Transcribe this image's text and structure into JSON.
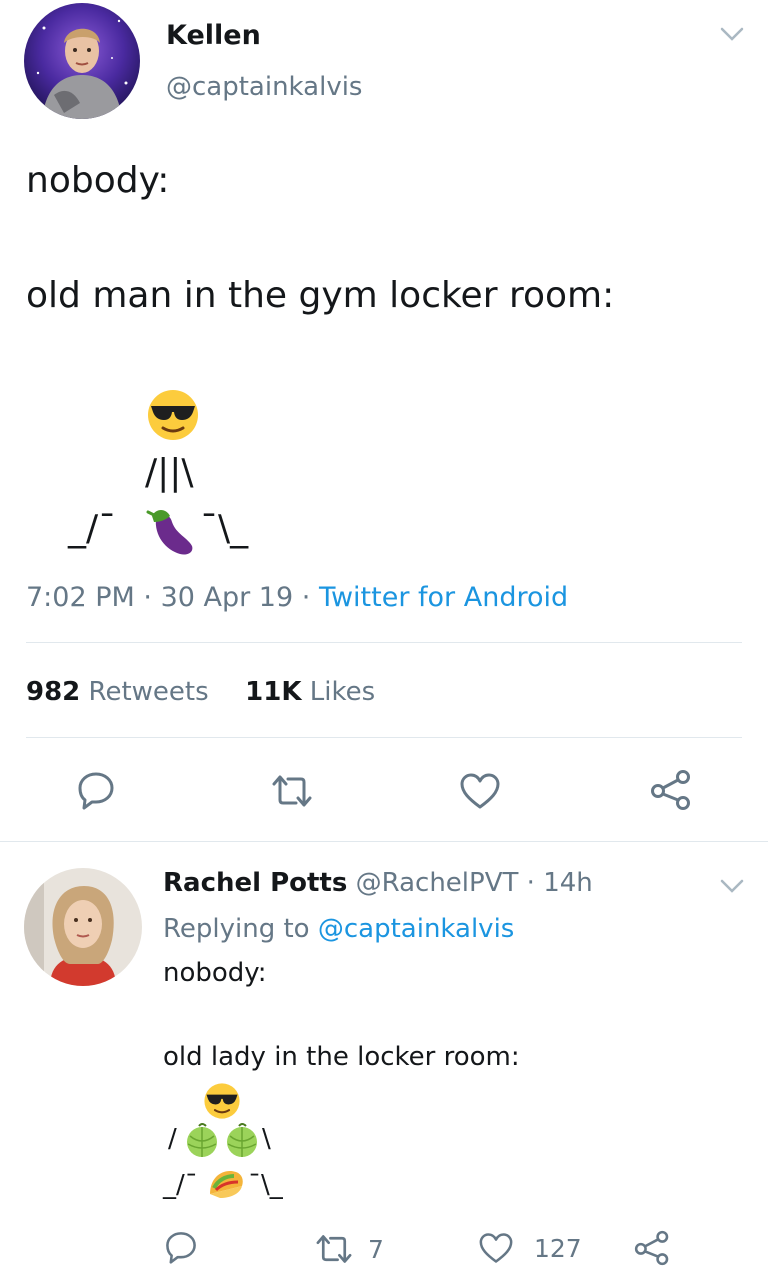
{
  "tweet": {
    "display_name": "Kellen",
    "handle": "@captainkalvis",
    "line1": "nobody:",
    "line2": "old man in the gym locker room:",
    "art_row2": "/||\\",
    "art_row3_left": "_/¯",
    "art_row3_right": "¯\\_",
    "time": "7:02 PM",
    "dot1": "·",
    "date": "30 Apr 19",
    "dot2": "·",
    "source": "Twitter for Android",
    "retweet_count": "982",
    "retweet_label": "Retweets",
    "like_count": "11K",
    "like_label": "Likes"
  },
  "reply": {
    "display_name": "Rachel Potts",
    "handle": "@RachelPVT",
    "dot": "·",
    "age": "14h",
    "replying_label": "Replying to",
    "replying_handle": "@captainkalvis",
    "line1": "nobody:",
    "line2": "old lady in the locker room:",
    "art_row2_left": "/",
    "art_row2_right": "\\",
    "art_row3_left": "_/¯",
    "art_row3_right": "¯\\_",
    "retweet_count": "7",
    "like_count": "127"
  },
  "icons": {
    "sunglasses": "sunglasses-emoji",
    "eggplant": "eggplant-emoji",
    "melon": "melon-emoji",
    "taco": "taco-emoji",
    "reply": "reply-icon",
    "retweet": "retweet-icon",
    "like": "heart-icon",
    "share": "share-icon",
    "chevron": "chevron-down-icon"
  },
  "colors": {
    "accent": "#1b95e0",
    "secondary_text": "#657786",
    "divider": "#e1e8ed"
  }
}
